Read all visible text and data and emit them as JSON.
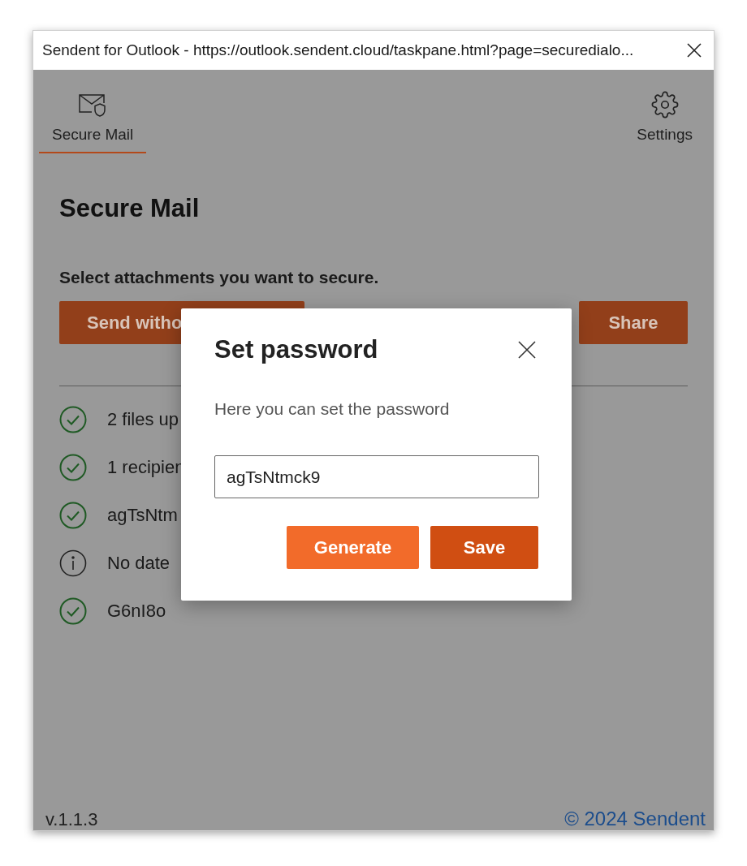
{
  "window": {
    "title": "Sendent for Outlook - https://outlook.sendent.cloud/taskpane.html?page=securedialo..."
  },
  "tabs": [
    {
      "label": "Secure Mail",
      "kind": "mail",
      "selected": true
    },
    {
      "label": "Settings",
      "kind": "settings",
      "selected": false
    }
  ],
  "page": {
    "heading": "Secure Mail",
    "instruction": "Select attachments you want to secure.",
    "buttons": [
      {
        "label": "Send witho",
        "kind": "wide"
      },
      {
        "label": "Share",
        "kind": "narrow"
      }
    ],
    "status": [
      {
        "kind": "check",
        "text": "2 files up"
      },
      {
        "kind": "check",
        "text": "1 recipien"
      },
      {
        "kind": "check",
        "text": "agTsNtm"
      },
      {
        "kind": "info",
        "text": "No date"
      },
      {
        "kind": "check",
        "text": "G6nI8o"
      }
    ],
    "footer": {
      "version": "v.1.1.3",
      "copyright": "© 2024 Sendent"
    }
  },
  "dialog": {
    "title": "Set password",
    "description": "Here you can set the password",
    "field": {
      "value": "agTsNtmck9"
    },
    "buttons": [
      {
        "label": "Generate",
        "kind": "secondary"
      },
      {
        "label": "Save",
        "kind": "primary"
      }
    ]
  }
}
